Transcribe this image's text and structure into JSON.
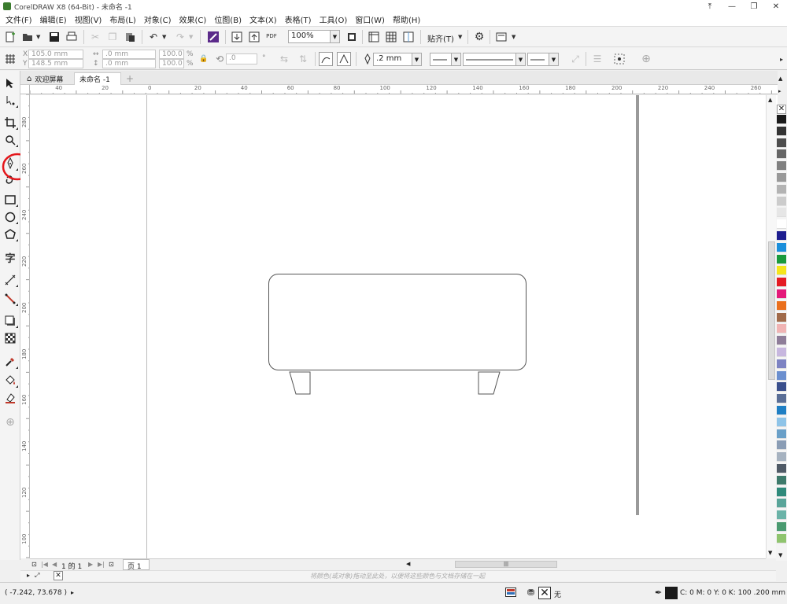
{
  "window": {
    "title": "CorelDRAW X8 (64-Bit) - 未命名 -1",
    "controls": [
      "⤒",
      "—",
      "❐",
      "✕"
    ]
  },
  "menu": {
    "items": [
      "文件(F)",
      "编辑(E)",
      "视图(V)",
      "布局(L)",
      "对象(C)",
      "效果(C)",
      "位图(B)",
      "文本(X)",
      "表格(T)",
      "工具(O)",
      "窗口(W)",
      "帮助(H)"
    ]
  },
  "standard_toolbar": {
    "zoom_value": "100%",
    "snap_label": "贴齐(T)",
    "pdf_label": "PDF"
  },
  "property_bar": {
    "x": "105.0 mm",
    "y": "148.5 mm",
    "width": ".0 mm",
    "height": ".0 mm",
    "scale_x": "100.0",
    "scale_y": "100.0",
    "percent": "%",
    "rotation": ".0",
    "outline_width": ".2 mm"
  },
  "doc_tabs": {
    "welcome": "欢迎屏幕",
    "document": "未命名 -1",
    "add": "+"
  },
  "rulers": {
    "h_labels": [
      "40",
      "20",
      "0",
      "20",
      "40",
      "60",
      "80",
      "100",
      "120",
      "140",
      "160",
      "180",
      "200",
      "220",
      "240",
      "260"
    ],
    "v_labels": [
      "280",
      "260",
      "240",
      "220",
      "200",
      "180",
      "160",
      "140",
      "120",
      "100"
    ]
  },
  "page_nav": {
    "page_count": "1 的 1",
    "page_tab": "页 1"
  },
  "color_dock": {
    "hint": "将颜色(或对象)拖动至此处，以便将这些颜色与文档存储在一起"
  },
  "status": {
    "coords": "( -7.242, 73.678 )",
    "fill_label": "无",
    "outline_info": "C: 0 M: 0 Y: 0 K: 100  .200 mm"
  },
  "palette_colors": [
    "#1a1a1a",
    "#333333",
    "#4d4d4d",
    "#666666",
    "#808080",
    "#999999",
    "#b3b3b3",
    "#cccccc",
    "#e6e6e6",
    "#ffffff",
    "#1d1d8f",
    "#1b8fdb",
    "#1a9a3c",
    "#f5e51b",
    "#e41b23",
    "#e4197a",
    "#ea6f1c",
    "#a06a4a",
    "#f0b4b4",
    "#8e7d99",
    "#c7b7df",
    "#7d83c3",
    "#6b8fcf",
    "#3a4f8c",
    "#5a6e96",
    "#1f7fc4",
    "#8fc4e8",
    "#6aa0c8",
    "#8a9db5",
    "#a6b2c0",
    "#4f5a66",
    "#3d7a6b",
    "#2f8a7b",
    "#5aa59a",
    "#6bb3a8",
    "#4a9a70",
    "#8fc46e"
  ],
  "accent": {
    "annotation_red": "#e4161b"
  }
}
